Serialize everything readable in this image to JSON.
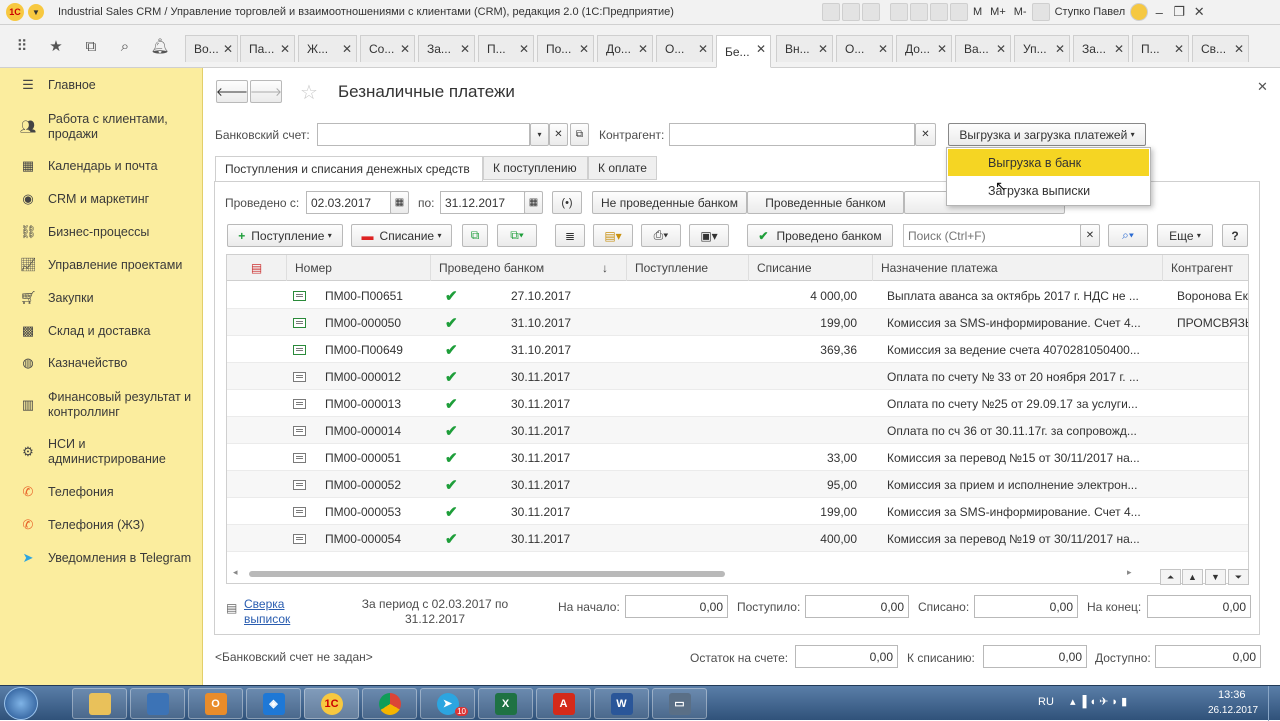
{
  "window": {
    "title": "Industrial Sales CRM / Управление торговлей и взаимоотношениями с клиентами (CRM), редакция 2.0  (1С:Предприятие)",
    "logo": "1С",
    "toolbar": {
      "m": "M",
      "mplus": "M+",
      "mminus": "M-",
      "user": "Ступко Павел"
    }
  },
  "tabs": [
    "Во...",
    "Па...",
    "Ж...",
    "Со...",
    "За...",
    "П...",
    "По...",
    "До...",
    "О...",
    "Бе...",
    "Вн...",
    "О...",
    "До...",
    "Ва...",
    "Уп...",
    "За...",
    "П...",
    "Св..."
  ],
  "sidebar": {
    "items": [
      {
        "label": "Главное",
        "icon": "menu-icon"
      },
      {
        "label": "Работа с клиентами, продажи",
        "icon": "clients-icon"
      },
      {
        "label": "Календарь и почта",
        "icon": "calendar-icon"
      },
      {
        "label": "CRM и маркетинг",
        "icon": "crm-icon"
      },
      {
        "label": "Бизнес-процессы",
        "icon": "process-icon"
      },
      {
        "label": "Управление проектами",
        "icon": "projects-icon"
      },
      {
        "label": "Закупки",
        "icon": "cart-icon"
      },
      {
        "label": "Склад и доставка",
        "icon": "warehouse-icon"
      },
      {
        "label": "Казначейство",
        "icon": "treasury-icon"
      },
      {
        "label": "Финансовый результат и контроллинг",
        "icon": "chart-icon"
      },
      {
        "label": "НСИ и администрирование",
        "icon": "gear-icon"
      },
      {
        "label": "Телефония",
        "icon": "phone-icon"
      },
      {
        "label": "Телефония (ЖЗ)",
        "icon": "phone-icon"
      },
      {
        "label": "Уведомления в Telegram",
        "icon": "telegram-icon"
      }
    ]
  },
  "form": {
    "title": "Безналичные платежи",
    "bank_account_label": "Банковский счет:",
    "bank_account_value": "",
    "counterparty_label": "Контрагент:",
    "counterparty_value": "",
    "exchange_button": "Выгрузка и загрузка платежей",
    "subtabs": [
      "Поступления и списания денежных средств",
      "К поступлению",
      "К оплате"
    ],
    "posted_from_label": "Проведено с:",
    "posted_from": "02.03.2017",
    "posted_to_label": "по:",
    "posted_to": "31.12.2017",
    "filter_buttons": [
      "Не проведенные банком",
      "Проведенные банком"
    ],
    "toolbar": {
      "income": "Поступление",
      "expense": "Списание",
      "posted_by_bank": "Проведено банком",
      "search_placeholder": "Поиск (Ctrl+F)",
      "more": "Еще",
      "help": "?"
    }
  },
  "dropdown": {
    "items": [
      "Выгрузка в банк",
      "Загрузка выписки"
    ]
  },
  "table": {
    "columns": [
      "Номер",
      "Проведено банком",
      "Поступление",
      "Списание",
      "Назначение платежа",
      "Контрагент"
    ],
    "sort_indicator": "↓",
    "rows": [
      {
        "number": "ПМ00-П00651",
        "posted": true,
        "date": "27.10.2017",
        "income": "",
        "expense": "4 000,00",
        "purpose": "Выплата аванса за октябрь 2017 г. НДС не ...",
        "counterparty": "Воронова Ек"
      },
      {
        "number": "ПМ00-000050",
        "posted": true,
        "date": "31.10.2017",
        "income": "",
        "expense": "199,00",
        "purpose": "Комиссия за SMS-информирование. Счет 4...",
        "counterparty": "ПРОМСВЯЗЬ"
      },
      {
        "number": "ПМ00-П00649",
        "posted": true,
        "date": "31.10.2017",
        "income": "",
        "expense": "369,36",
        "purpose": "Комиссия за ведение счета 4070281050400...",
        "counterparty": ""
      },
      {
        "number": "ПМ00-000012",
        "posted": true,
        "date": "30.11.2017",
        "income": "",
        "expense": "",
        "purpose": "Оплата по счету № 33 от 20 ноября 2017 г. ...",
        "counterparty": ""
      },
      {
        "number": "ПМ00-000013",
        "posted": true,
        "date": "30.11.2017",
        "income": "",
        "expense": "",
        "purpose": "Оплата по счету №25 от 29.09.17 за услуги...",
        "counterparty": ""
      },
      {
        "number": "ПМ00-000014",
        "posted": true,
        "date": "30.11.2017",
        "income": "",
        "expense": "",
        "purpose": "Оплата по сч 36 от 30.11.17г. за сопровожд...",
        "counterparty": ""
      },
      {
        "number": "ПМ00-000051",
        "posted": true,
        "date": "30.11.2017",
        "income": "",
        "expense": "33,00",
        "purpose": "Комиссия за перевод №15 от 30/11/2017 на...",
        "counterparty": ""
      },
      {
        "number": "ПМ00-000052",
        "posted": true,
        "date": "30.11.2017",
        "income": "",
        "expense": "95,00",
        "purpose": "Комиссия за прием и исполнение электрон...",
        "counterparty": ""
      },
      {
        "number": "ПМ00-000053",
        "posted": true,
        "date": "30.11.2017",
        "income": "",
        "expense": "199,00",
        "purpose": "Комиссия за SMS-информирование. Счет 4...",
        "counterparty": ""
      },
      {
        "number": "ПМ00-000054",
        "posted": true,
        "date": "30.11.2017",
        "income": "",
        "expense": "400,00",
        "purpose": "Комиссия за перевод №19 от 30/11/2017 на...",
        "counterparty": ""
      }
    ]
  },
  "summary": {
    "reconcile_link": "Сверка выписок",
    "period_text": "За период с 02.03.2017 по 31.12.2017",
    "start_label": "На начало:",
    "start_value": "0,00",
    "received_label": "Поступило:",
    "received_value": "0,00",
    "spent_label": "Списано:",
    "spent_value": "0,00",
    "end_label": "На конец:",
    "end_value": "0,00"
  },
  "footer": {
    "account_note": "<Банковский счет не задан>",
    "balance_label": "Остаток на счете:",
    "balance_value": "0,00",
    "to_spend_label": "К списанию:",
    "to_spend_value": "0,00",
    "available_label": "Доступно:",
    "available_value": "0,00"
  },
  "taskbar": {
    "lang": "RU",
    "time": "13:36",
    "date": "26.12.2017",
    "telegram_badge": "10"
  },
  "colors": {
    "sidebar_bg": "#fbed9e",
    "dropdown_highlight": "#f5d523",
    "check_green": "#1e9e3a"
  }
}
